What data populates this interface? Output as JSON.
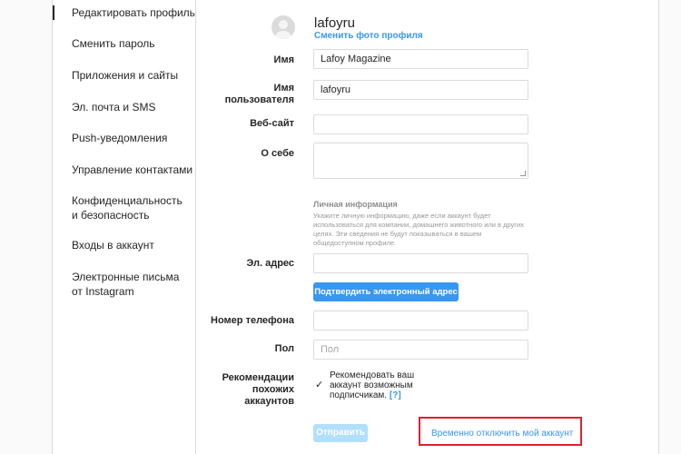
{
  "sidebar": {
    "items": [
      {
        "label": "Редактировать профиль",
        "active": true
      },
      {
        "label": "Сменить пароль"
      },
      {
        "label": "Приложения и сайты"
      },
      {
        "label": "Эл. почта и SMS"
      },
      {
        "label": "Push-уведомления"
      },
      {
        "label": "Управление контактами"
      },
      {
        "label": "Конфиденциальность и безопасность"
      },
      {
        "label": "Входы в аккаунт"
      },
      {
        "label": "Электронные письма от Instagram"
      }
    ]
  },
  "profile": {
    "username": "lafoyru",
    "change_photo_label": "Сменить фото профиля"
  },
  "form": {
    "name_label": "Имя",
    "name_value": "Lafoy Magazine",
    "username_label_1": "Имя",
    "username_label_2": "пользователя",
    "username_value": "lafoyru",
    "website_label": "Веб-сайт",
    "website_value": "",
    "bio_label": "О себе",
    "bio_value": "",
    "personal_info_title": "Личная информация",
    "personal_info_text": "Укажите личную информацию, даже если аккаунт будет использоваться для компании, домашнего животного или в других целях. Эти сведения не будут показываться в вашем общедоступном профиле.",
    "email_label": "Эл. адрес",
    "email_value": "",
    "confirm_email_button": "Подтвердить электронный адрес",
    "phone_label": "Номер телефона",
    "phone_value": "",
    "gender_label": "Пол",
    "gender_placeholder": "Пол",
    "recommend_label_1": "Рекомендации",
    "recommend_label_2": "похожих",
    "recommend_label_3": "аккаунтов",
    "recommend_checked": true,
    "recommend_checkmark": "✓",
    "recommend_text": "Рекомендовать ваш аккаунт возможным подписчикам.",
    "recommend_help": "[?]",
    "submit_button": "Отправить",
    "disable_account_link": "Временно отключить мой аккаунт"
  },
  "colors": {
    "accent": "#3897f0",
    "highlight": "#e0202e"
  }
}
